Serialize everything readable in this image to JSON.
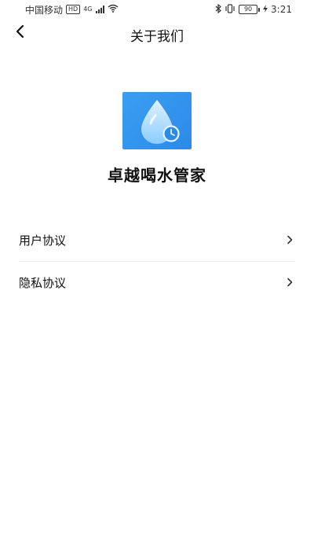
{
  "status_bar": {
    "carrier": "中国移动",
    "hd": "HD",
    "network": "4G",
    "battery": "90",
    "time": "3:21"
  },
  "nav": {
    "title": "关于我们"
  },
  "app": {
    "name": "卓越喝水管家"
  },
  "menu": {
    "items": [
      {
        "label": "用户协议"
      },
      {
        "label": "隐私协议"
      }
    ]
  },
  "colors": {
    "logo_bg": "#2c8ae8",
    "drop": "#cfeaff",
    "divider": "#eeeeee"
  }
}
